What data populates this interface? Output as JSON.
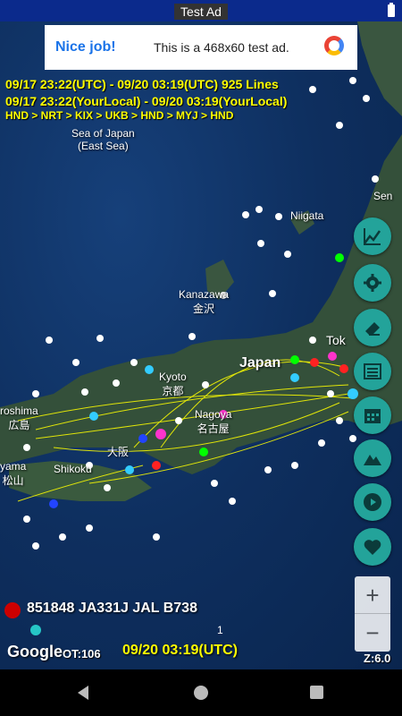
{
  "ad": {
    "label": "Test Ad",
    "headline": "Nice job!",
    "text": "This is a 468x60 test ad."
  },
  "info": {
    "utc_range": "09/17 23:22(UTC) - 09/20 03:19(UTC) 925 Lines",
    "local_range": "09/17 23:22(YourLocal) - 09/20 03:19(YourLocal)",
    "route": "HND > NRT > KIX > UKB > HND > MYJ > HND"
  },
  "map": {
    "labels": {
      "sea_of_japan": "Sea of Japan",
      "east_sea": "(East Sea)",
      "niigata": "Niigata",
      "kanazawa": "Kanazawa",
      "kanazawa_jp": "金沢",
      "kyoto": "Kyoto",
      "kyoto_jp": "京都",
      "japan": "Japan",
      "nagoya": "Nagoya",
      "nagoya_jp": "名古屋",
      "tokyo": "Tok",
      "hiroshima": "roshima",
      "hiroshima_jp": "広島",
      "matsuyama": "yama",
      "matsuyama_jp": "松山",
      "shikoku": "Shikoku",
      "osaka_jp": "大阪",
      "sendai": "Sen"
    },
    "colors": {
      "route_lines": "#ffff00",
      "land": "#2f4a2f",
      "sea": "#0e2f5f"
    }
  },
  "buttons": {
    "chart": "chart-icon",
    "settings": "gear-icon",
    "eraser": "eraser-icon",
    "list": "list-icon",
    "calendar": "calendar-icon",
    "terrain": "mountain-icon",
    "play": "play-icon",
    "favorite": "heart-icon",
    "accent": "#23a39a"
  },
  "zoom": {
    "in": "+",
    "out": "−",
    "level": "Z:6.0"
  },
  "selected": {
    "flight": "851848 JA331J JAL B738",
    "seek_count": "1"
  },
  "footer": {
    "google": "Google",
    "ot": "OT:106",
    "time": "09/20 03:19(UTC)"
  }
}
